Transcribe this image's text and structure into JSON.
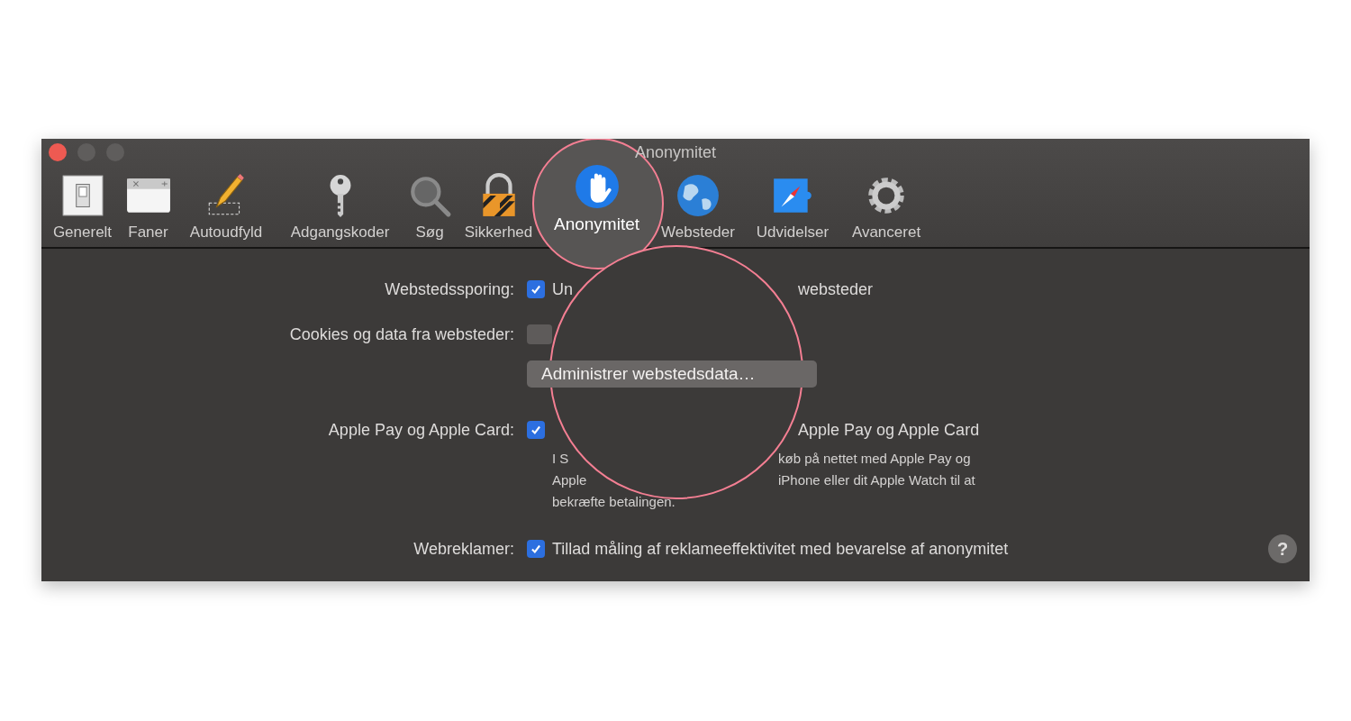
{
  "window": {
    "title": "Anonymitet"
  },
  "toolbar": [
    {
      "label": "Generelt",
      "selected": false
    },
    {
      "label": "Faner",
      "selected": false
    },
    {
      "label": "Autoudfyld",
      "selected": false
    },
    {
      "label": "Adgangskoder",
      "selected": false
    },
    {
      "label": "Søg",
      "selected": false
    },
    {
      "label": "Sikkerhed",
      "selected": false
    },
    {
      "label": "Anonymitet",
      "selected": true
    },
    {
      "label": "Websteder",
      "selected": false
    },
    {
      "label": "Udvidelser",
      "selected": false
    },
    {
      "label": "Avanceret",
      "selected": false
    }
  ],
  "settings": [
    {
      "kind": "checkbox",
      "label": "Webstedssporing:",
      "checked": true,
      "text_before": "Un",
      "text_after": "websteder"
    },
    {
      "kind": "popup",
      "label": "Cookies og data fra websteder:",
      "button": "Administrer webstedsdata…"
    },
    {
      "kind": "checkbox",
      "label": "Apple Pay og Apple Card:",
      "checked": true,
      "text_after": "Apple Pay og Apple Card",
      "description": [
        {
          "before": "I S",
          "after": "køb på nettet med Apple Pay og"
        },
        {
          "before": "Apple",
          "after": "iPhone eller dit Apple Watch til at"
        },
        {
          "before": "bekræfte betalingen."
        }
      ]
    },
    {
      "kind": "checkbox",
      "label": "Webreklamer:",
      "checked": true,
      "text_before": "Tillad måling af reklameeffektivitet med bevarelse af anonymitet"
    }
  ],
  "help_button": "?"
}
